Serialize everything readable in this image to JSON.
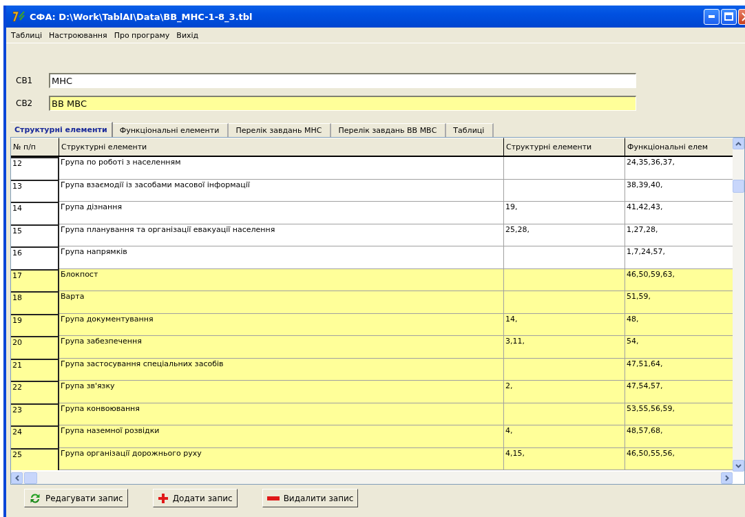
{
  "window": {
    "title": "СФА:  D:\\Work\\TablAI\\Data\\BB_MHC-1-8_3.tbl"
  },
  "menu": [
    "Таблиці",
    "Настроювання",
    "Про програму",
    "Вихід"
  ],
  "fields": [
    {
      "label": "СВ1",
      "value": "МНС",
      "highlighted": false
    },
    {
      "label": "СВ2",
      "value": "ВВ МВС",
      "highlighted": true
    }
  ],
  "tabs": [
    {
      "label": "Структурні елементи",
      "selected": true
    },
    {
      "label": "Функціональні елементи",
      "selected": false
    },
    {
      "label": "Перелік завдань МНС",
      "selected": false
    },
    {
      "label": "Перелік завдань ВВ МВС",
      "selected": false
    },
    {
      "label": "Таблиці",
      "selected": false
    }
  ],
  "table": {
    "columns": [
      "№ п/п",
      "Структурні елементи",
      "Структурні елементи",
      "Функціональні елем"
    ],
    "rows": [
      {
        "cells": [
          "12",
          "Група по роботі з населенням",
          "",
          "24,35,36,37,"
        ],
        "highlighted": false
      },
      {
        "cells": [
          "13",
          "Група взаємодії із засобами масової інформації",
          "",
          "38,39,40,"
        ],
        "highlighted": false
      },
      {
        "cells": [
          "14",
          "Група дізнання",
          "19,",
          "41,42,43,"
        ],
        "highlighted": false
      },
      {
        "cells": [
          "15",
          "Група планування та організації евакуації населення",
          "25,28,",
          "1,27,28,"
        ],
        "highlighted": false
      },
      {
        "cells": [
          "16",
          "Група напрямків",
          "",
          "1,7,24,57,"
        ],
        "highlighted": false
      },
      {
        "cells": [
          "17",
          "Блокпост",
          "",
          "46,50,59,63,"
        ],
        "highlighted": true
      },
      {
        "cells": [
          "18",
          "Варта",
          "",
          "51,59,"
        ],
        "highlighted": true
      },
      {
        "cells": [
          "19",
          "Група документування",
          "14,",
          "48,"
        ],
        "highlighted": true
      },
      {
        "cells": [
          "20",
          "Група забезпечення",
          "3,11,",
          "54,"
        ],
        "highlighted": true
      },
      {
        "cells": [
          "21",
          "Група застосування спеціальних засобів",
          "",
          "47,51,64,"
        ],
        "highlighted": true
      },
      {
        "cells": [
          "22",
          "Група зв'язку",
          "2,",
          "47,54,57,"
        ],
        "highlighted": true
      },
      {
        "cells": [
          "23",
          "Група конвоювання",
          "",
          "53,55,56,59,"
        ],
        "highlighted": true
      },
      {
        "cells": [
          "24",
          "Група наземної розвідки",
          "4,",
          "48,57,68,"
        ],
        "highlighted": true
      },
      {
        "cells": [
          "25",
          "Група організації дорожнього руху",
          "4,15,",
          "46,50,55,56,"
        ],
        "highlighted": true
      }
    ]
  },
  "buttons": [
    {
      "label": "Редагувати запис",
      "kind": "edit"
    },
    {
      "label": "Додати запис",
      "kind": "add"
    },
    {
      "label": "Видалити запис",
      "kind": "delete"
    }
  ]
}
